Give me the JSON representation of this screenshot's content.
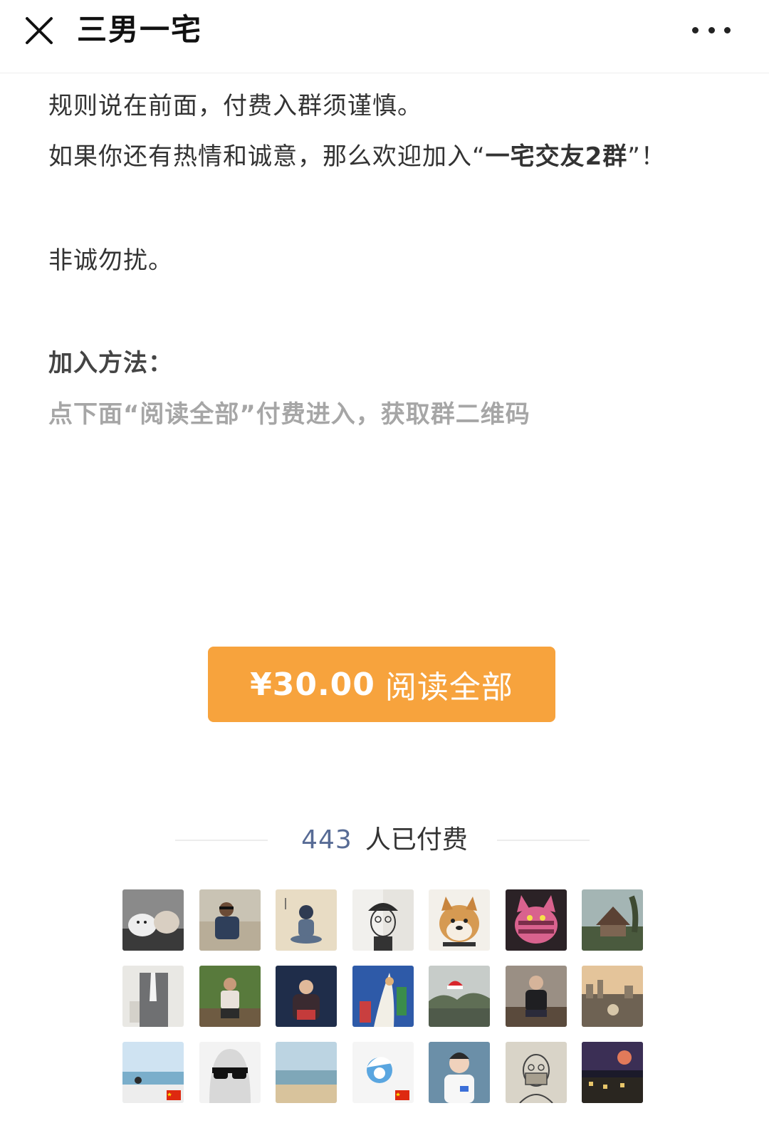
{
  "header": {
    "title": "三男一宅",
    "close_icon": "close-icon",
    "more_icon": "more-dots-icon"
  },
  "article": {
    "line1": "规则说在前面，付费入群须谨慎。",
    "line2_prefix": "如果你还有热情和诚意，那么欢迎加入“",
    "line2_bold": "一宅交友2群",
    "line2_suffix": "”！",
    "line3": "非诚勿扰。",
    "heading": "加入方法：",
    "instruction": "点下面“阅读全部”付费进入，获取群二维码"
  },
  "pay_button": {
    "price": "¥30.00",
    "label": "阅读全部",
    "color": "#f7a33d"
  },
  "paid": {
    "count": "443",
    "label": "人已付费",
    "count_color": "#576b95"
  },
  "avatars": [
    {
      "name": "avatar-cats"
    },
    {
      "name": "avatar-man-city"
    },
    {
      "name": "avatar-drawing-sitting"
    },
    {
      "name": "avatar-sketch-officer"
    },
    {
      "name": "avatar-shiba-dog"
    },
    {
      "name": "avatar-pink-cat-plush"
    },
    {
      "name": "avatar-house-landscape"
    },
    {
      "name": "avatar-suit"
    },
    {
      "name": "avatar-man-forest"
    },
    {
      "name": "avatar-man-dark"
    },
    {
      "name": "avatar-painting"
    },
    {
      "name": "avatar-christmas-hat"
    },
    {
      "name": "avatar-man-sitting"
    },
    {
      "name": "avatar-sunset-city"
    },
    {
      "name": "avatar-beach-flag"
    },
    {
      "name": "avatar-ghost-sunglasses"
    },
    {
      "name": "avatar-seascape"
    },
    {
      "name": "avatar-smurf-flag"
    },
    {
      "name": "avatar-man-white-shirt"
    },
    {
      "name": "avatar-sketch-mask"
    },
    {
      "name": "avatar-night-city"
    }
  ]
}
